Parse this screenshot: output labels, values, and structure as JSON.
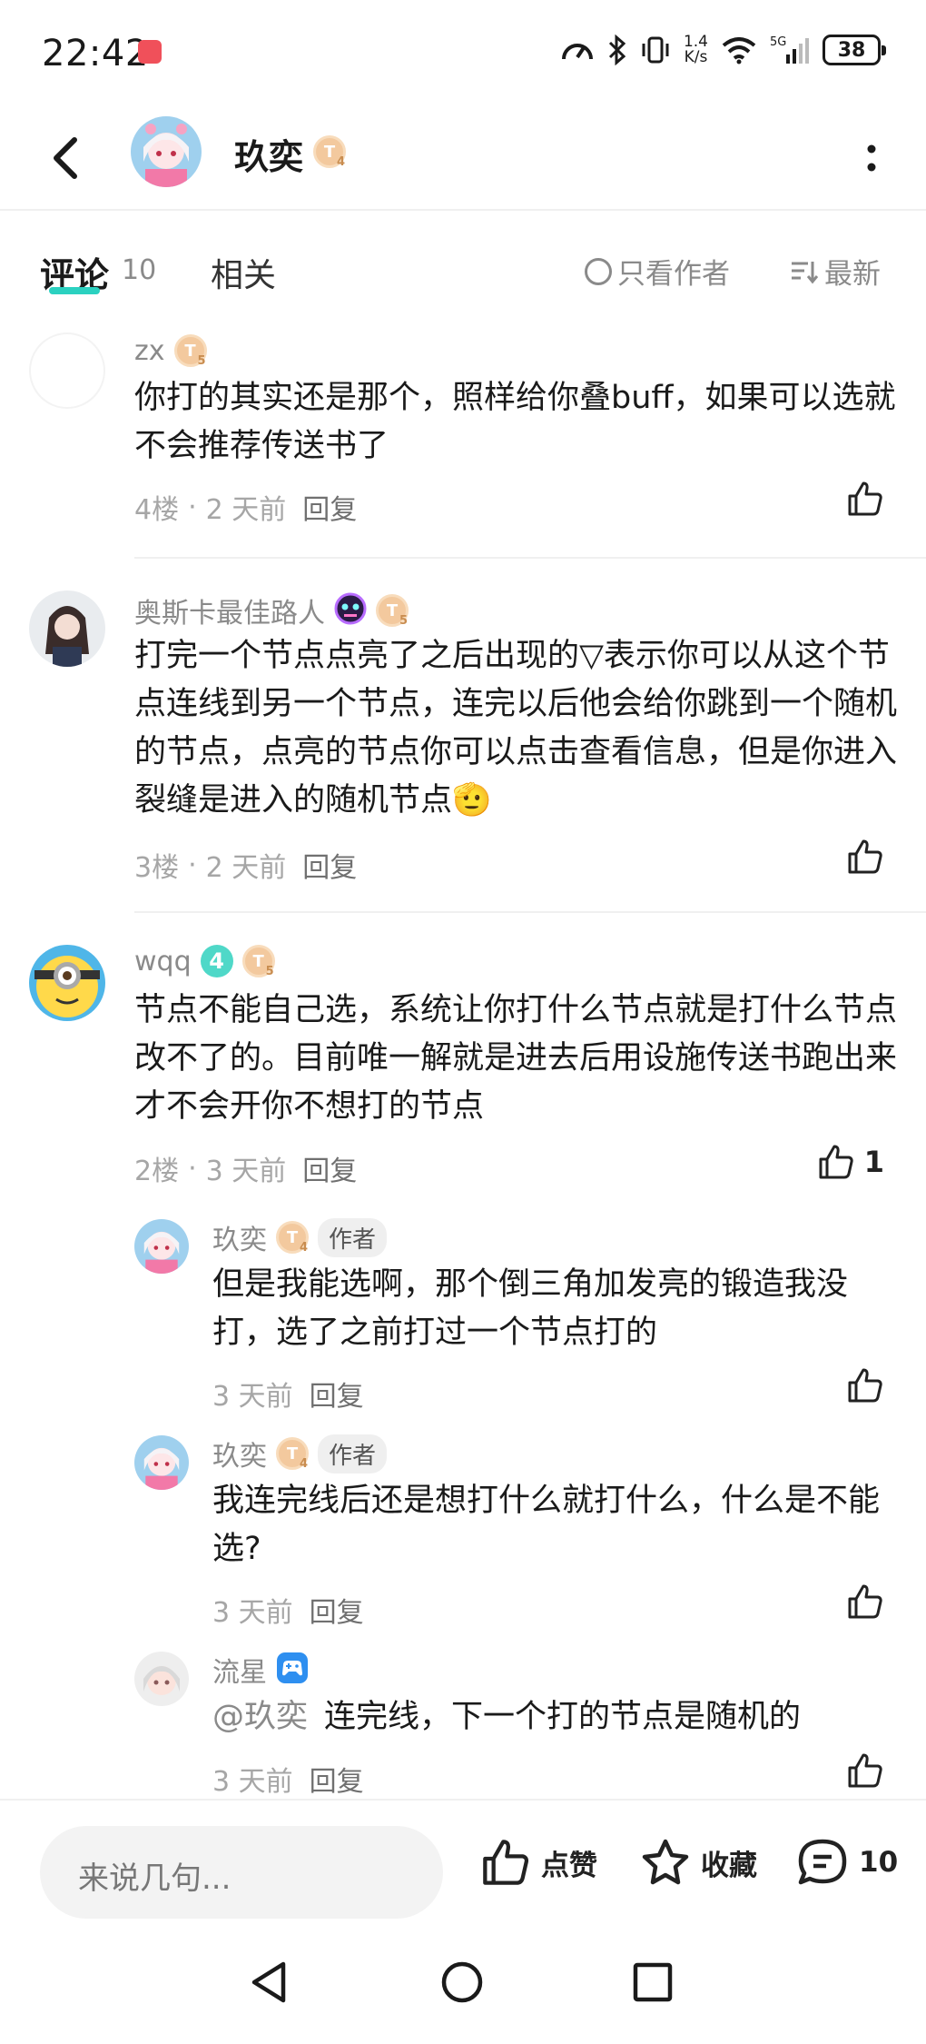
{
  "status_bar": {
    "time": "22:42",
    "net_speed_value": "1.4",
    "net_speed_unit": "K/s",
    "network": "5G",
    "battery": "38"
  },
  "header": {
    "title": "玖奕",
    "level_badge": "T",
    "level_num": "4"
  },
  "tabs": {
    "comments_label": "评论",
    "comments_count": "10",
    "related_label": "相关",
    "author_only_label": "只看作者",
    "sort_label": "最新"
  },
  "comments": [
    {
      "name": "zx",
      "level_num": "5",
      "text": "你打的其实还是那个，照样给你叠buff，如果可以选就不会推荐传送书了",
      "floor": "4楼",
      "time": "2 天前",
      "reply_label": "回复",
      "likes": ""
    },
    {
      "name": "奥斯卡最佳路人",
      "level_num": "5",
      "text": "打完一个节点点亮了之后出现的▽表示你可以从这个节点连线到另一个节点，连完以后他会给你跳到一个随机的节点，点亮的节点你可以点击查看信息，但是你进入裂缝是进入的随机节点",
      "emoji": "🫡",
      "floor": "3楼",
      "time": "2 天前",
      "reply_label": "回复",
      "likes": ""
    },
    {
      "name": "wqq",
      "level_num": "5",
      "badge_num": "4",
      "text": "节点不能自己选，系统让你打什么节点就是打什么节点改不了的。目前唯一解就是进去后用设施传送书跑出来才不会开你不想打的节点",
      "floor": "2楼",
      "time": "3 天前",
      "reply_label": "回复",
      "likes": "1"
    }
  ],
  "replies": [
    {
      "name": "玖奕",
      "level_num": "4",
      "tag": "作者",
      "text": "但是我能选啊，那个倒三角加发亮的锻造我没打，选了之前打过一个节点打的",
      "time": "3 天前",
      "reply_label": "回复"
    },
    {
      "name": "玖奕",
      "level_num": "4",
      "tag": "作者",
      "text": "我连完线后还是想打什么就打什么，什么是不能选?",
      "time": "3 天前",
      "reply_label": "回复"
    },
    {
      "name": "流星",
      "mention": "@玖奕",
      "text": "连完线，下一个打的节点是随机的",
      "time": "3 天前",
      "reply_label": "回复"
    }
  ],
  "bottom_bar": {
    "input_placeholder": "来说几句...",
    "like_label": "点赞",
    "fav_label": "收藏",
    "comment_count": "10"
  },
  "colors": {
    "accent": "#2bd1c0",
    "level_badge": "#f3c99e",
    "meta_text": "#a6a6a6"
  }
}
